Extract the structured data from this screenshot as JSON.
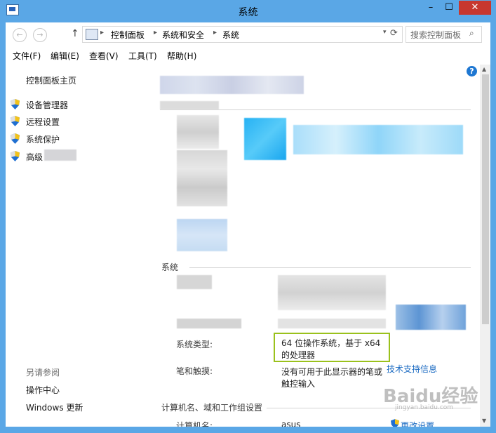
{
  "window": {
    "title": "系统",
    "minimize": "–",
    "maximize": "☐",
    "close": "✕"
  },
  "address_bar": {
    "back": "←",
    "forward": "→",
    "up": "↑",
    "crumbs": [
      "控制面板",
      "系统和安全",
      "系统"
    ],
    "separator": "▸",
    "dropdown": "▾",
    "refresh": "⟳",
    "search_placeholder": "搜索控制面板",
    "search_icon": "⌕"
  },
  "menu": [
    "文件(F)",
    "编辑(E)",
    "查看(V)",
    "工具(T)",
    "帮助(H)"
  ],
  "sidebar": {
    "home": "控制面板主页",
    "items": [
      "设备管理器",
      "远程设置",
      "系统保护",
      "高级"
    ],
    "see_also_header": "另请参阅",
    "see_also": [
      "操作中心",
      "Windows 更新"
    ]
  },
  "help_icon": "?",
  "main": {
    "system_section": "系统",
    "rows": [
      {
        "label": "系统类型:",
        "value_line1": "64 位操作系统，基于 x64",
        "value_line2": "的处理器"
      },
      {
        "label": "笔和触摸:",
        "value_line1": "没有可用于此显示器的笔或",
        "value_line2": "触控输入"
      }
    ],
    "tech_support": "技术支持信息",
    "computer_section": "计算机名、域和工作组设置",
    "computer_name_label": "计算机名:",
    "computer_name_value": "asus",
    "change_settings": "更改设置"
  },
  "watermark": {
    "text": "Baidu经验",
    "sub": "jingyan.baidu.com"
  },
  "colors": {
    "titlebar": "#5aa7e6",
    "close": "#c7372f",
    "link": "#1a6ac2",
    "highlight_box": "#9ac11c"
  }
}
